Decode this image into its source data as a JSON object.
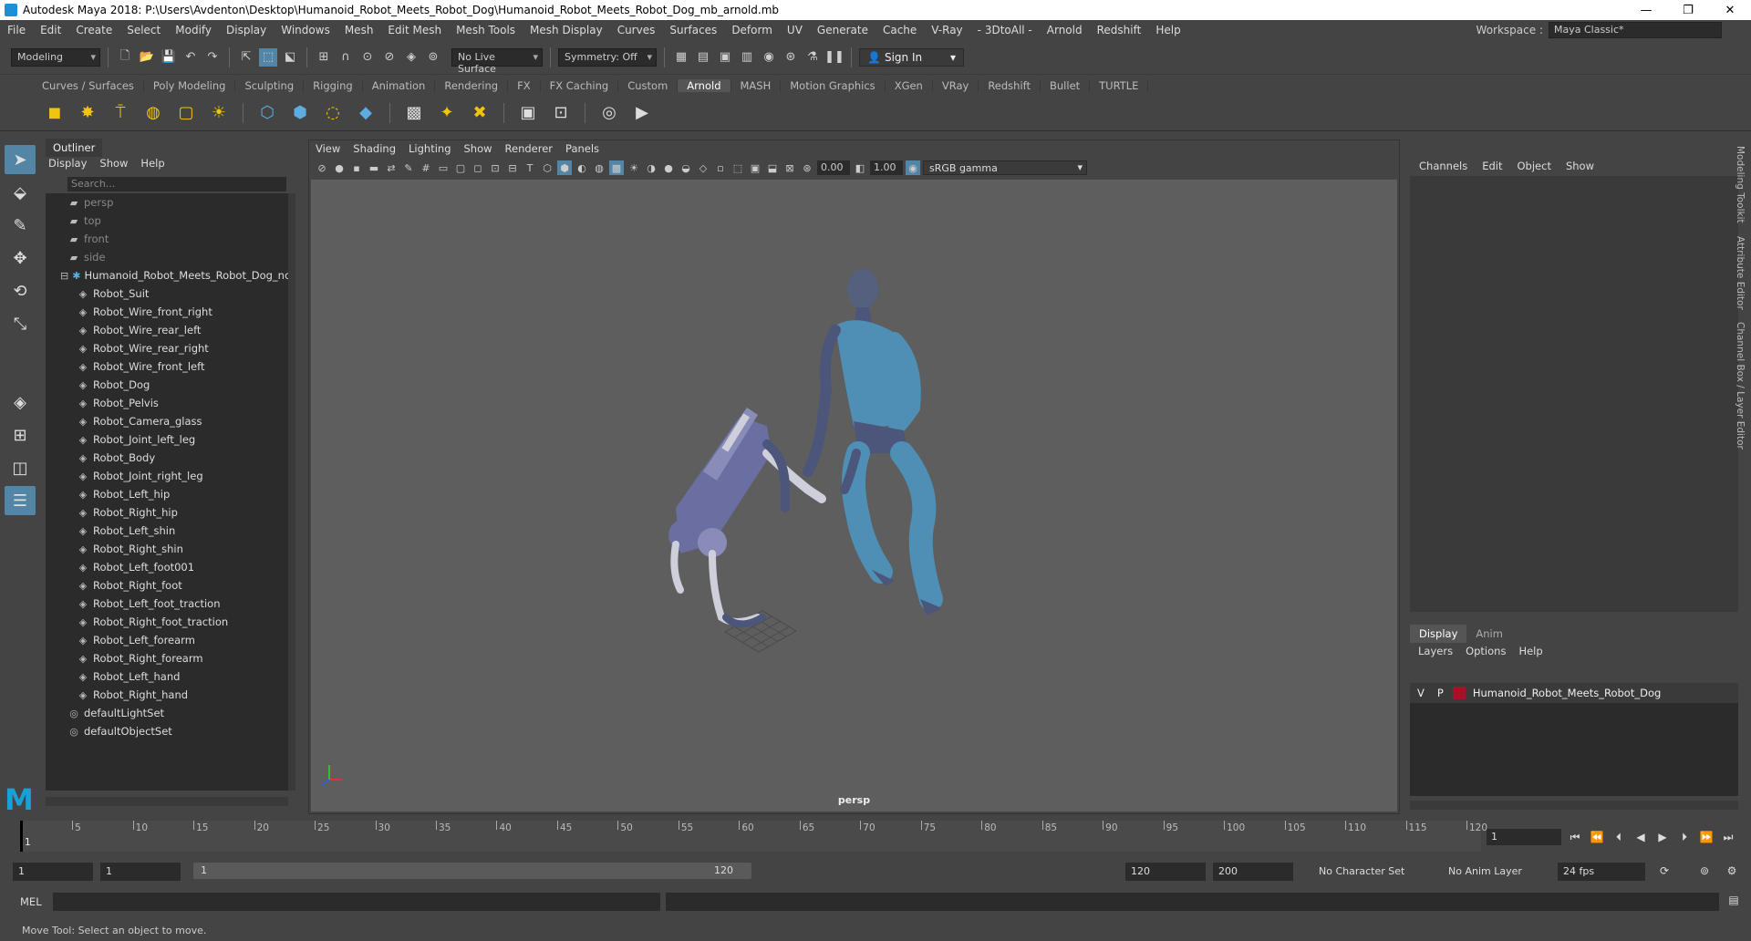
{
  "window": {
    "title": "Autodesk Maya 2018: P:\\Users\\Avdenton\\Desktop\\Humanoid_Robot_Meets_Robot_Dog\\Humanoid_Robot_Meets_Robot_Dog_mb_arnold.mb",
    "minimize": "—",
    "maximize": "❐",
    "close": "✕"
  },
  "menubar": {
    "items": [
      "File",
      "Edit",
      "Create",
      "Select",
      "Modify",
      "Display",
      "Windows",
      "Mesh",
      "Edit Mesh",
      "Mesh Tools",
      "Mesh Display",
      "Curves",
      "Surfaces",
      "Deform",
      "UV",
      "Generate",
      "Cache",
      "V-Ray",
      "- 3DtoAll -",
      "Arnold",
      "Redshift",
      "Help"
    ],
    "workspace_label": "Workspace :",
    "workspace_value": "Maya Classic*"
  },
  "statusline": {
    "mode": "Modeling",
    "live_surface": "No Live Surface",
    "symmetry": "Symmetry: Off",
    "sign_in": "Sign In"
  },
  "shelf": {
    "tabs": [
      "Curves / Surfaces",
      "Poly Modeling",
      "Sculpting",
      "Rigging",
      "Animation",
      "Rendering",
      "FX",
      "FX Caching",
      "Custom",
      "Arnold",
      "MASH",
      "Motion Graphics",
      "XGen",
      "VRay",
      "Redshift",
      "Bullet",
      "TURTLE"
    ],
    "active_tab": "Arnold"
  },
  "outliner": {
    "title": "Outliner",
    "menu": [
      "Display",
      "Show",
      "Help"
    ],
    "search_placeholder": "Search...",
    "items": [
      {
        "label": "persp",
        "icon": "camera-icon",
        "indent": 1,
        "dim": true
      },
      {
        "label": "top",
        "icon": "camera-icon",
        "indent": 1,
        "dim": true
      },
      {
        "label": "front",
        "icon": "camera-icon",
        "indent": 1,
        "dim": true
      },
      {
        "label": "side",
        "icon": "camera-icon",
        "indent": 1,
        "dim": true
      },
      {
        "label": "Humanoid_Robot_Meets_Robot_Dog_ncl",
        "icon": "group-icon",
        "indent": 0,
        "dim": false
      },
      {
        "label": "Robot_Suit",
        "icon": "mesh-icon",
        "indent": 2,
        "dim": false
      },
      {
        "label": "Robot_Wire_front_right",
        "icon": "mesh-icon",
        "indent": 2,
        "dim": false
      },
      {
        "label": "Robot_Wire_rear_left",
        "icon": "mesh-icon",
        "indent": 2,
        "dim": false
      },
      {
        "label": "Robot_Wire_rear_right",
        "icon": "mesh-icon",
        "indent": 2,
        "dim": false
      },
      {
        "label": "Robot_Wire_front_left",
        "icon": "mesh-icon",
        "indent": 2,
        "dim": false
      },
      {
        "label": "Robot_Dog",
        "icon": "mesh-icon",
        "indent": 2,
        "dim": false
      },
      {
        "label": "Robot_Pelvis",
        "icon": "mesh-icon",
        "indent": 2,
        "dim": false
      },
      {
        "label": "Robot_Camera_glass",
        "icon": "mesh-icon",
        "indent": 2,
        "dim": false
      },
      {
        "label": "Robot_Joint_left_leg",
        "icon": "mesh-icon",
        "indent": 2,
        "dim": false
      },
      {
        "label": "Robot_Body",
        "icon": "mesh-icon",
        "indent": 2,
        "dim": false
      },
      {
        "label": "Robot_Joint_right_leg",
        "icon": "mesh-icon",
        "indent": 2,
        "dim": false
      },
      {
        "label": "Robot_Left_hip",
        "icon": "mesh-icon",
        "indent": 2,
        "dim": false
      },
      {
        "label": "Robot_Right_hip",
        "icon": "mesh-icon",
        "indent": 2,
        "dim": false
      },
      {
        "label": "Robot_Left_shin",
        "icon": "mesh-icon",
        "indent": 2,
        "dim": false
      },
      {
        "label": "Robot_Right_shin",
        "icon": "mesh-icon",
        "indent": 2,
        "dim": false
      },
      {
        "label": "Robot_Left_foot001",
        "icon": "mesh-icon",
        "indent": 2,
        "dim": false
      },
      {
        "label": "Robot_Right_foot",
        "icon": "mesh-icon",
        "indent": 2,
        "dim": false
      },
      {
        "label": "Robot_Left_foot_traction",
        "icon": "mesh-icon",
        "indent": 2,
        "dim": false
      },
      {
        "label": "Robot_Right_foot_traction",
        "icon": "mesh-icon",
        "indent": 2,
        "dim": false
      },
      {
        "label": "Robot_Left_forearm",
        "icon": "mesh-icon",
        "indent": 2,
        "dim": false
      },
      {
        "label": "Robot_Right_forearm",
        "icon": "mesh-icon",
        "indent": 2,
        "dim": false
      },
      {
        "label": "Robot_Left_hand",
        "icon": "mesh-icon",
        "indent": 2,
        "dim": false
      },
      {
        "label": "Robot_Right_hand",
        "icon": "mesh-icon",
        "indent": 2,
        "dim": false
      },
      {
        "label": "defaultLightSet",
        "icon": "set-icon",
        "indent": 1,
        "dim": false
      },
      {
        "label": "defaultObjectSet",
        "icon": "set-icon",
        "indent": 1,
        "dim": false
      }
    ]
  },
  "viewport": {
    "menu": [
      "View",
      "Shading",
      "Lighting",
      "Show",
      "Renderer",
      "Panels"
    ],
    "exposure": "0.00",
    "gamma": "1.00",
    "color_space": "sRGB gamma",
    "camera_label": "persp"
  },
  "channel_box": {
    "menu": [
      "Channels",
      "Edit",
      "Object",
      "Show"
    ]
  },
  "layer_editor": {
    "tabs": [
      "Display",
      "Anim"
    ],
    "active_tab": "Display",
    "menu": [
      "Layers",
      "Options",
      "Help"
    ],
    "layer": {
      "v": "V",
      "p": "P",
      "name": "Humanoid_Robot_Meets_Robot_Dog",
      "color": "#a8102a"
    }
  },
  "side_tabs": [
    "Modeling Toolkit",
    "Attribute Editor",
    "Channel Box / Layer Editor"
  ],
  "timeline": {
    "ticks": [
      "5",
      "10",
      "15",
      "20",
      "25",
      "30",
      "35",
      "40",
      "45",
      "50",
      "55",
      "60",
      "65",
      "70",
      "75",
      "80",
      "85",
      "90",
      "95",
      "100",
      "105",
      "110",
      "115",
      "120"
    ],
    "current_frame": "1",
    "current_frame_marker": "1"
  },
  "range": {
    "start_anim": "1",
    "start_range": "1",
    "slider_start": "1",
    "slider_end": "120",
    "end_range": "120",
    "end_anim": "200",
    "character_set": "No Character Set",
    "anim_layer": "No Anim Layer",
    "fps": "24 fps"
  },
  "command": {
    "label": "MEL"
  },
  "help_line": "Move Tool: Select an object to move."
}
